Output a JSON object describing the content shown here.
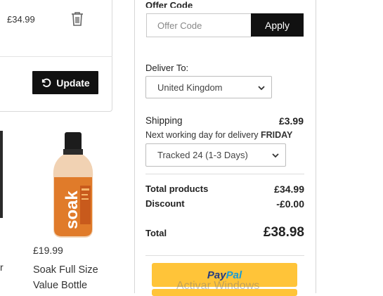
{
  "basket": {
    "item_price": "£34.99",
    "update_label": "Update"
  },
  "products": {
    "left_partial_text": "r",
    "item": {
      "price": "£19.99",
      "name_line1": "Soak Full Size",
      "name_line2": "Value Bottle",
      "bottle_label": "soak"
    }
  },
  "checkout": {
    "offer_label": "Offer Code",
    "offer_placeholder": "Offer Code",
    "apply_label": "Apply",
    "deliver_label": "Deliver To:",
    "country_selected": "United Kingdom",
    "shipping_label": "Shipping",
    "shipping_value": "£3.99",
    "delivery_note": "Next working day for delivery",
    "delivery_day": "FRIDAY",
    "shipping_method": "Tracked 24 (1-3 Days)",
    "total_products_label": "Total products",
    "total_products_value": "£34.99",
    "discount_label": "Discount",
    "discount_value": "-£0.00",
    "total_label": "Total",
    "total_value": "£38.98",
    "paypal_pay": "Pay",
    "paypal_pal": "Pal"
  },
  "system": {
    "watermark": "Activar Windows"
  },
  "icons": {
    "trash": "trash-icon",
    "update": "refresh-icon",
    "select": "chevron-down-icon"
  },
  "colors": {
    "button_dark": "#111111",
    "paypal_yellow": "#ffc439",
    "paypal_navy": "#253b80",
    "paypal_blue": "#179bd7",
    "bottle_orange": "#e07b2a"
  }
}
